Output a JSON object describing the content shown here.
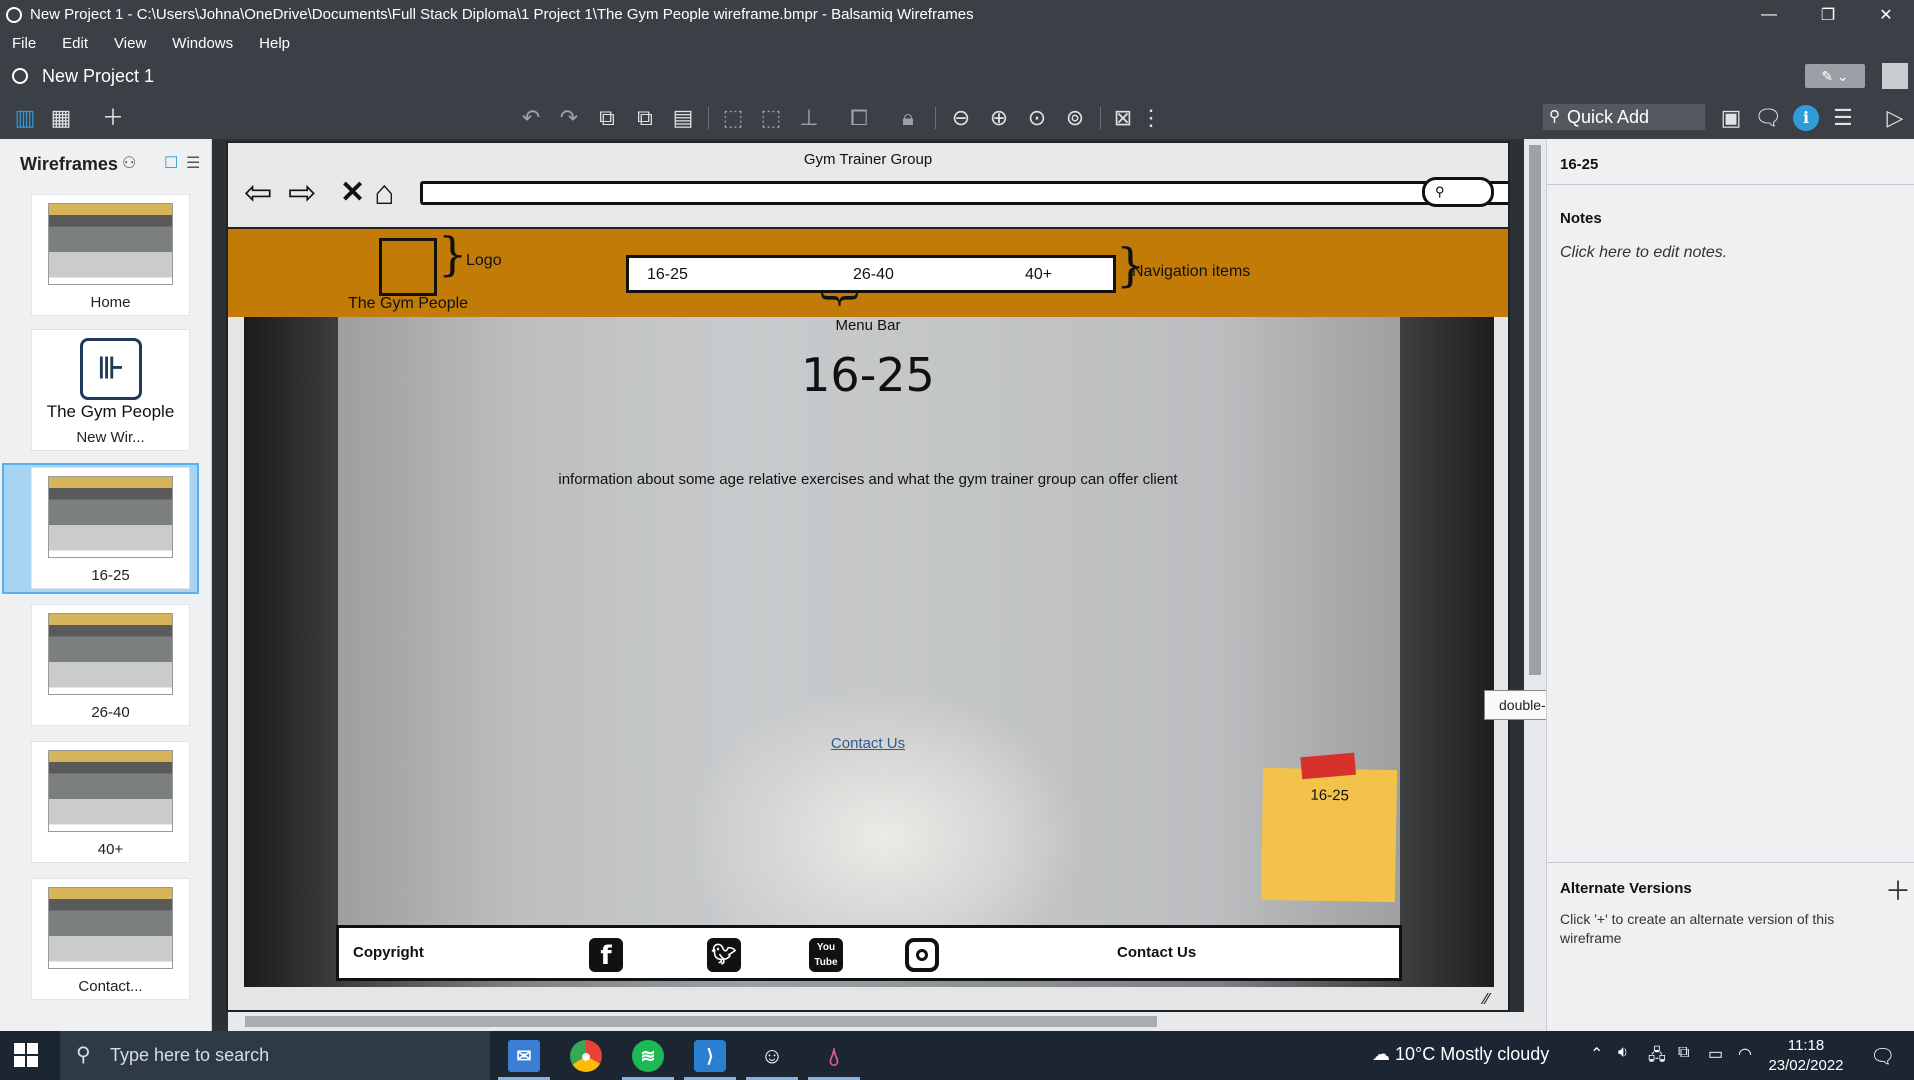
{
  "window": {
    "title": "New Project 1 - C:\\Users\\Johna\\OneDrive\\Documents\\Full Stack Diploma\\1 Project 1\\The Gym People wireframe.bmpr - Balsamiq Wireframes",
    "minimize": "—",
    "maximize": "❐",
    "close": "✕"
  },
  "menu": [
    "File",
    "Edit",
    "View",
    "Windows",
    "Help"
  ],
  "project": {
    "name": "New Project 1"
  },
  "toolbar": {
    "quick_add": "Quick Add"
  },
  "left_panel": {
    "title": "Wireframes",
    "items": [
      {
        "label": "Home"
      },
      {
        "label": "New Wir...",
        "logo_text": "The Gym People"
      },
      {
        "label": "16-25",
        "selected": true
      },
      {
        "label": "26-40"
      },
      {
        "label": "40+"
      },
      {
        "label": "Contact..."
      }
    ]
  },
  "wireframe": {
    "browser_title": "Gym Trainer Group",
    "logo_label": "Logo",
    "brand": "The Gym People",
    "nav": [
      "16-25",
      "26-40",
      "40+"
    ],
    "nav_label": "Navigation items",
    "menu_bar_label": "Menu Bar",
    "heading": "16-25",
    "info": "information about some age relative exercises and what the gym trainer group can offer client",
    "contact_link": "Contact Us",
    "sticky_note": "16-25",
    "footer": {
      "copyright": "Copyright",
      "contact": "Contact Us",
      "youtube": "You Tube"
    }
  },
  "tooltip": "double-click to select image",
  "right_panel": {
    "title": "16-25",
    "notes_heading": "Notes",
    "notes_placeholder": "Click here to edit notes.",
    "alt_heading": "Alternate Versions",
    "alt_text": "Click '+' to create an alternate version of this wireframe"
  },
  "taskbar": {
    "search_placeholder": "Type here to search",
    "weather": "10°C  Mostly cloudy",
    "time": "11:18",
    "date": "23/02/2022"
  }
}
